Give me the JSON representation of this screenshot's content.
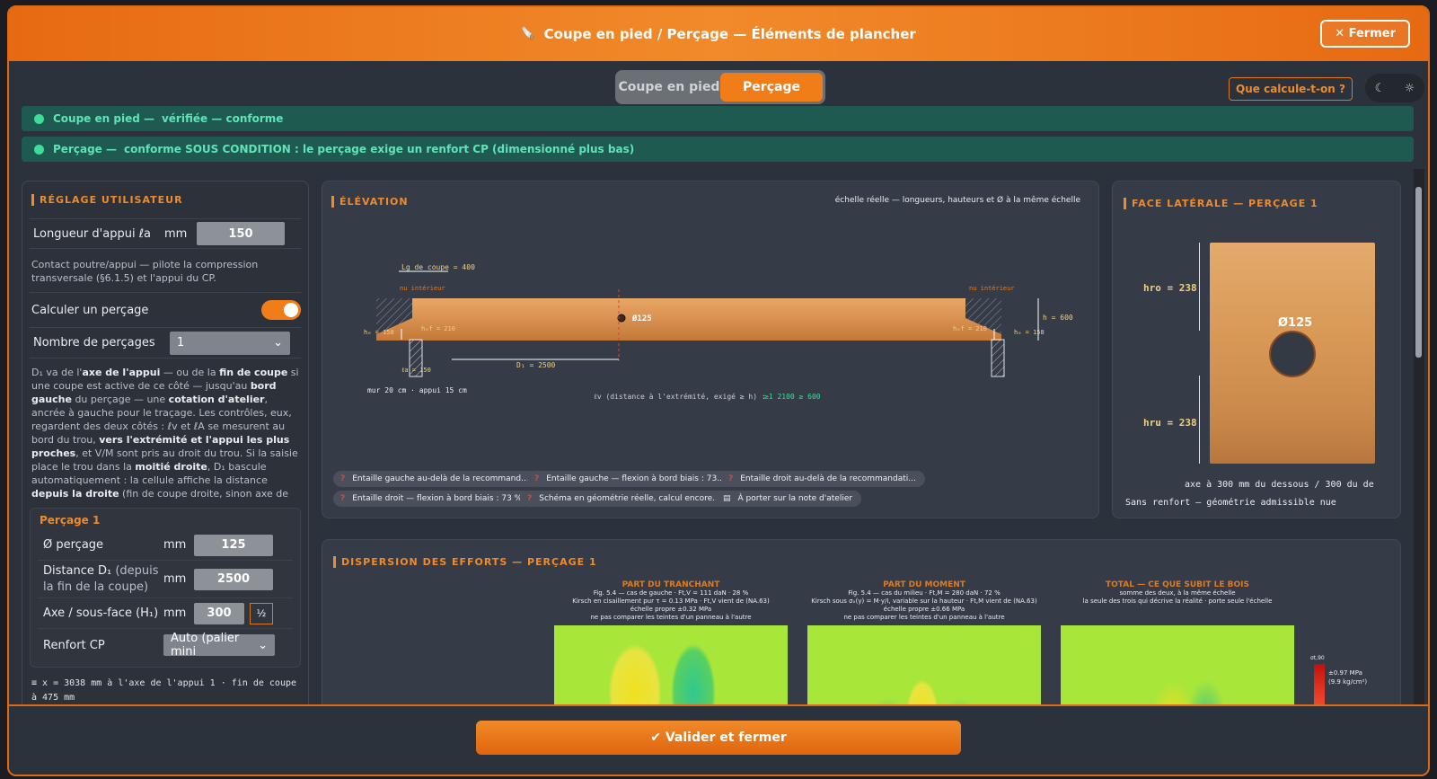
{
  "header": {
    "title": "Coupe en pied / Perçage — Éléments de plancher",
    "close_label": "✕ Fermer"
  },
  "tabs": [
    {
      "label": "Coupe en pied"
    },
    {
      "label": "Perçage"
    }
  ],
  "help_label": "Que calcule-t-on ?",
  "theme": {
    "moon": "☾",
    "sun": "☼"
  },
  "status": [
    {
      "name": "Coupe en pied —",
      "text": "vérifiée — conforme"
    },
    {
      "name": "Perçage —",
      "text": "conforme SOUS CONDITION : le perçage exige un renfort CP (dimensionné plus bas)"
    }
  ],
  "left": {
    "title": "RÉGLAGE UTILISATEUR",
    "appui_label": "Longueur d'appui ℓa",
    "appui_unit": "mm",
    "appui_value": "150",
    "appui_help": "Contact poutre/appui — pilote la compression transversale (§6.1.5) et l'appui du CP.",
    "percage_toggle_label": "Calculer un perçage",
    "nb_label": "Nombre de perçages",
    "nb_value": "1",
    "d1_p1": "D₁ va de l'",
    "d1_b1": "axe de l'appui",
    "d1_p2": " — ou de la ",
    "d1_b2": "fin de coupe",
    "d1_p3": " si une coupe est active de ce côté — jusqu'au ",
    "d1_b3": "bord gauche",
    "d1_p4": " du perçage — une ",
    "d1_b4": "cotation d'atelier",
    "d1_p5": ", ancrée à gauche pour le traçage. Les contrôles, eux, regardent des deux côtés : ℓv et ℓA se mesurent au bord du trou, ",
    "d1_b5": "vers l'extrémité et l'appui les plus proches",
    "d1_p6": ", et V/M sont pris au droit du trou. Si la saisie place le trou dans la ",
    "d1_b6": "moitié droite",
    "d1_p7": ", D₁ bascule automatiquement : la cellule affiche la distance ",
    "d1_b7": "depuis la droite",
    "d1_p8": " (fin de coupe droite, sinon axe de l'appui droit) et le schéma cote de ce côté.",
    "p1_title": "Perçage 1",
    "diam_label": "Ø perçage",
    "diam_unit": "mm",
    "diam_value": "125",
    "dist_label": "Distance D₁",
    "dist_sub": " (depuis la fin de la coupe)",
    "dist_unit": "mm",
    "dist_value": "2500",
    "axe_label": "Axe / sous-face (H₁)",
    "axe_unit": "mm",
    "axe_value": "300",
    "half_label": "½",
    "renfort_label": "Renfort CP",
    "renfort_value": "Auto (palier mini",
    "footnote": "≡ x = 3038 mm à l'axe de l'appui 1 · fin de coupe à 475 mm"
  },
  "elev": {
    "title": "ÉLÉVATION",
    "scale": "échelle réelle — longueurs, hauteurs et Ø à la même échelle",
    "lg": "Lg de coupe = 400",
    "nu_l": "nu intérieur",
    "nu_r": "nu intérieur",
    "diam": "Ø125",
    "h": "h = 600",
    "hr_l": "hₑ = 158",
    "hr_r": "hₑ = 158",
    "hef_l": "hₑf = 210",
    "hef_r": "hₑf = 210",
    "la": "ℓa = 150",
    "d1": "D₁ = 2500",
    "mur": "mur 20 cm · appui 15 cm",
    "lv": "ℓv (distance à l'extrémité, exigé ≥ h) :",
    "lv_val": "≥1 2100 ≥ 600",
    "chips": [
      "Entaille gauche au-delà de la recommand...",
      "Entaille gauche — flexion à bord biais : 73...",
      "Entaille droit au-delà de la recommandati...",
      "Entaille droit — flexion à bord biais : 73 %",
      "Schéma en géométrie réelle, calcul encore...",
      "À porter sur la note d'atelier"
    ]
  },
  "face": {
    "title": "FACE LATÉRALE — PERÇAGE 1",
    "hro": "hro = 238",
    "hru": "hru = 238",
    "diam": "Ø125",
    "axe": "axe à 300 mm du dessous / 300 du de",
    "sans": "Sans renfort — géométrie admissible nue"
  },
  "disp": {
    "title": "DISPERSION DES EFFORTS — PERÇAGE 1",
    "cols": [
      {
        "t": "PART DU TRANCHANT",
        "l1": "Fig. 5.4 — cas de gauche · Ft,V = 111 daN · 28 %",
        "l2": "Kirsch en cisaillement pur τ = 0.13 MPa · Ft,V vient de (NA.63)",
        "l3": "échelle propre ±0.32 MPa",
        "l4": "ne pas comparer les teintes d'un panneau à l'autre"
      },
      {
        "t": "PART DU MOMENT",
        "l1": "Fig. 5.4 — cas du milieu · Ft,M = 280 daN · 72 %",
        "l2": "Kirsch sous σₓ(y) = M·y/I, variable sur la hauteur · Ft,M vient de (NA.63)",
        "l3": "échelle propre ±0.66 MPa",
        "l4": "ne pas comparer les teintes d'un panneau à l'autre"
      },
      {
        "t": "TOTAL — CE QUE SUBIT LE BOIS",
        "l1": "somme des deux, à la même échelle",
        "l2": "la seule des trois qui décrive la réalité · porte seule l'échelle",
        "l3": "",
        "l4": ""
      }
    ],
    "legend_t": "σt,90",
    "legend_v": "±0.97 MPa",
    "legend_k": "(9.9 kg/cm²)"
  },
  "footer": {
    "valid_label": "✔ Valider et fermer"
  }
}
